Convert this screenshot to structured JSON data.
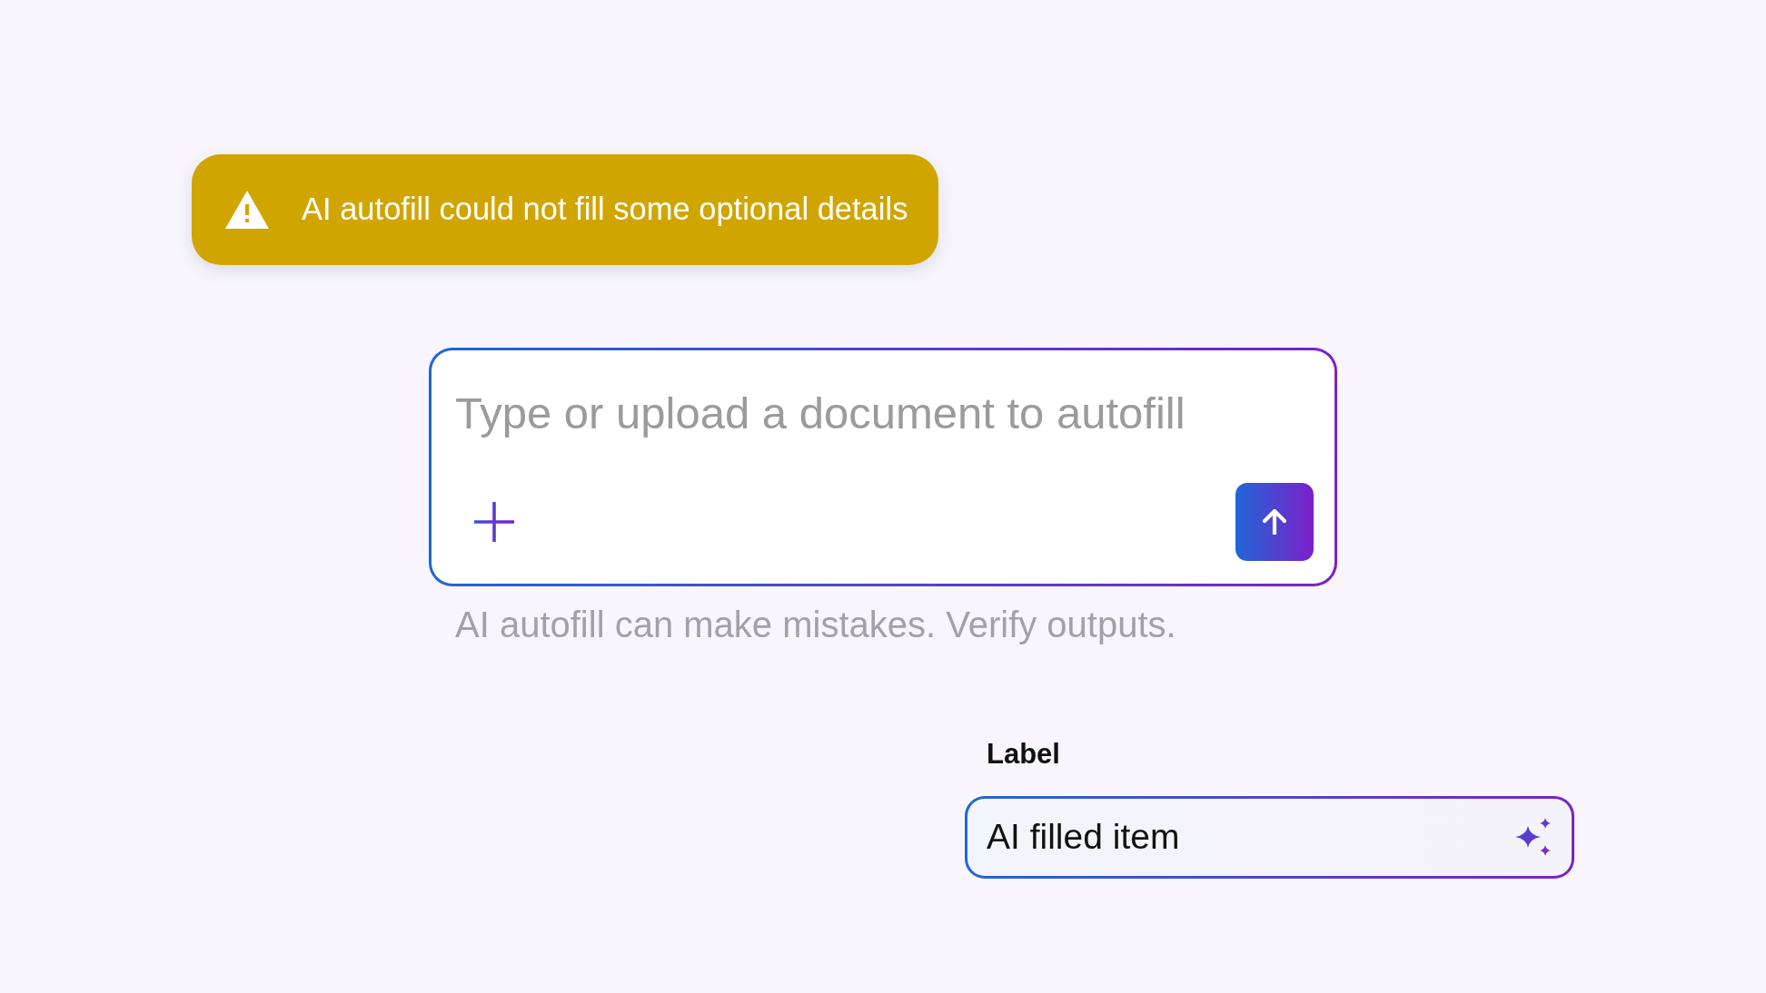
{
  "alert": {
    "kind": "warning",
    "message": "AI autofill could not fill some optional details"
  },
  "composer": {
    "placeholder": "Type or upload a document to autofill",
    "disclaimer": "AI autofill can make mistakes. Verify outputs."
  },
  "field": {
    "label": "Label",
    "value": "AI filled item",
    "ai_filled": true
  }
}
